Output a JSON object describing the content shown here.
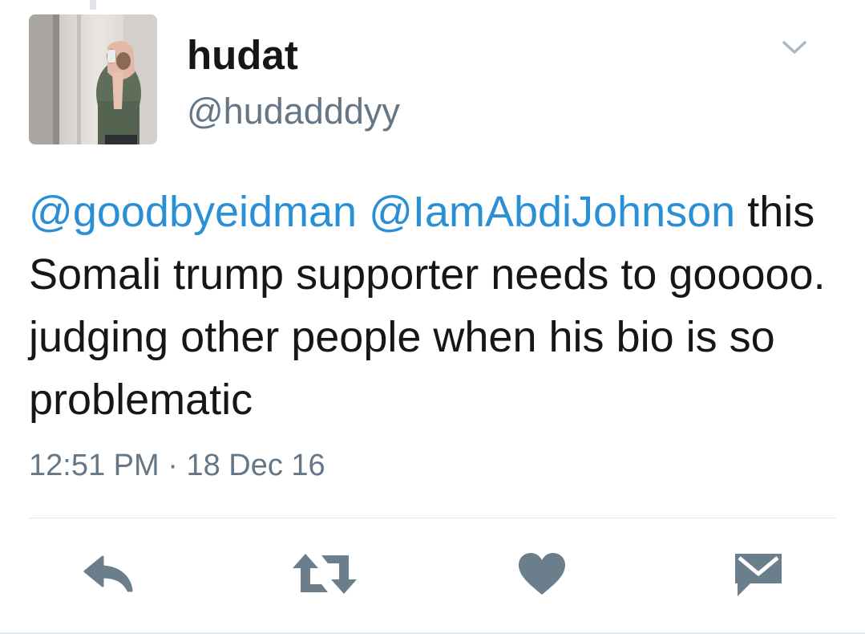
{
  "user": {
    "display_name": "hudat",
    "handle": "@hudadddyy"
  },
  "tweet": {
    "mention_1": "@goodbyeidman",
    "mention_2": "@IamAbdiJohnson",
    "body": "this Somali trump supporter needs to gooooo. judging other people when his bio is so problematic",
    "time": "12:51 PM",
    "separator": "·",
    "date": "18 Dec 16"
  },
  "icons": {
    "menu": "chevron-down-icon",
    "reply": "reply-icon",
    "retweet": "retweet-icon",
    "like": "heart-icon",
    "dm": "envelope-icon"
  },
  "colors": {
    "text": "#14171a",
    "secondary": "#657786",
    "mention": "#2b8fd6",
    "action_icon": "#6b7e8c",
    "divider": "#e1e8ed"
  }
}
